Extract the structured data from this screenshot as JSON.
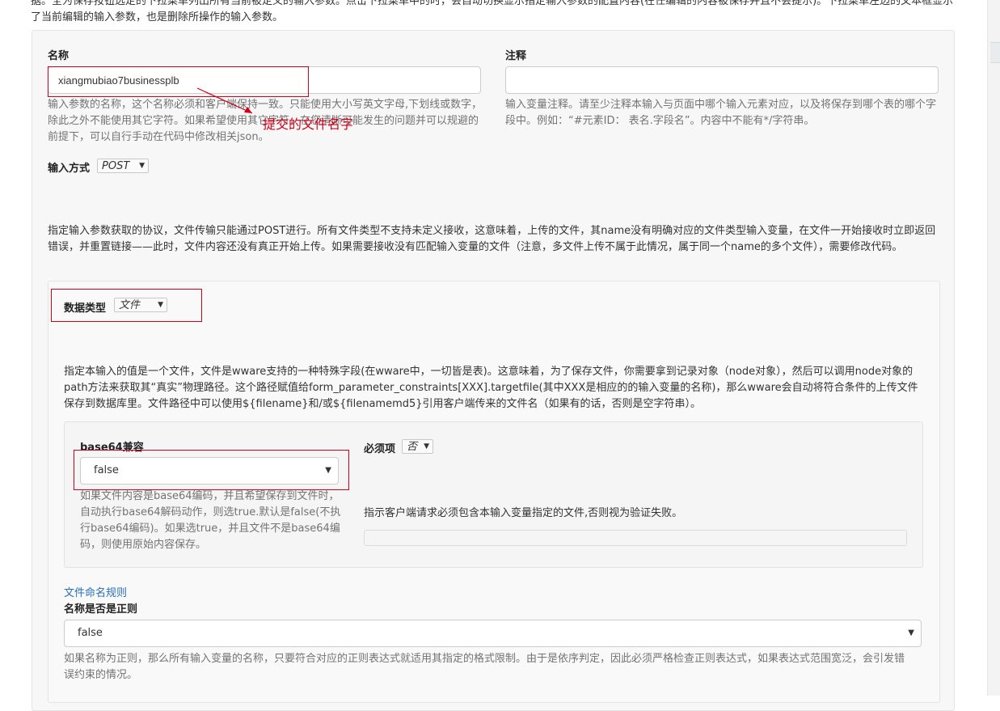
{
  "intro_text": "据。全为保存按钮选定的下拉菜单列出所有当前被定义的输入参数。点击下拉菜单中的时，会自动切换显示指定输入参数的配置内容(在任编辑的内容被保存并且不会提示)。下拉菜单左边的文本框显示了当前编辑的输入参数，也是删除所操作的输入参数。",
  "name_field": {
    "label": "名称",
    "value": "xiangmubiao7businessplb",
    "help": "输入参数的名称，这个名称必须和客户端保持一致。只能使用大小写英文字母,下划线或数字，除此之外不能使用其它字符。如果希望使用其它字符，在您清晰可能发生的问题并可以规避的前提下，可以自行手动在代码中修改相关json。",
    "annotation": "提交的文件名字"
  },
  "comment_field": {
    "label": "注释",
    "value": "",
    "help": "输入变量注释。请至少注释本输入与页面中哪个输入元素对应，以及将保存到哪个表的哪个字段中。例如：“#元素ID： 表名.字段名”。内容中不能有*/字符串。"
  },
  "input_method": {
    "label": "输入方式",
    "value": "POST",
    "description": "指定输入参数获取的协议，文件传输只能通过POST进行。所有文件类型不支持未定义接收，这意味着，上传的文件，其name没有明确对应的文件类型输入变量，在文件一开始接收时立即返回错误，并重置链接——此时，文件内容还没有真正开始上传。如果需要接收没有匹配输入变量的文件（注意，多文件上传不属于此情况，属于同一个name的多个文件），需要修改代码。"
  },
  "data_type": {
    "label": "数据类型",
    "value": "文件",
    "description": "指定本输入的值是一个文件，文件是wware支持的一种特殊字段(在wware中，一切皆是表)。这意味着，为了保存文件，你需要拿到记录对象（node对象），然后可以调用node对象的path方法来获取其“真实”物理路径。这个路径赋值给form_parameter_constraints[XXX].targetfile(其中XXX是相应的的输入变量的名称)，那么wware会自动将符合条件的上传文件保存到数据库里。文件路径中可以使用${filename}和/或${filenamemd5}引用客户端传来的文件名（如果有的话，否则是空字符串）。"
  },
  "base64": {
    "label": "base64兼容",
    "value": "false",
    "help": "如果文件内容是base64编码，并且希望保存到文件时，自动执行base64解码动作，则选true.默认是false(不执行base64编码)。如果选true，并且文件不是base64编码，则使用原始内容保存。"
  },
  "required": {
    "label": "必须项",
    "value": "否",
    "help": "指示客户端请求必须包含本输入变量指定的文件,否则视为验证失败。"
  },
  "naming_rule": {
    "link": "文件命名规则",
    "label": "名称是否是正则",
    "value": "false",
    "help": "如果名称为正则，那么所有输入变量的名称，只要符合对应的正则表达式就适用其指定的格式限制。由于是依序判定，因此必须严格检查正则表达式，如果表达式范围宽泛，会引发错误约束的情况。"
  },
  "colors": {
    "annotation_red": "#d0021b",
    "link_blue": "#2a6eb5"
  }
}
